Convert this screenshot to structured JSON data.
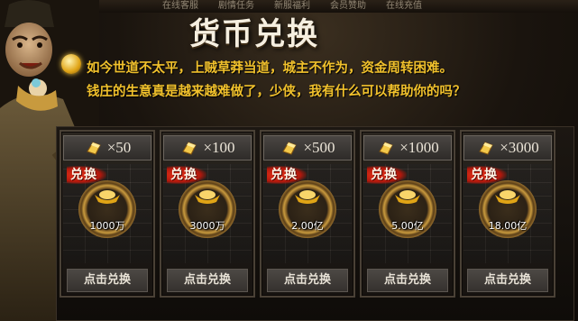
{
  "topbar": {
    "items": [
      "在线客服",
      "剧情任务",
      "新服福利",
      "会员赞助",
      "在线充值"
    ]
  },
  "title": "货币兑换",
  "dialog": {
    "line1": "如今世道不太平，上贼草莽当道，城主不作为，资金周转困难。",
    "line2": "钱庄的生意真是越来越难做了，少侠，我有什么可以帮助你的吗？"
  },
  "badge_label": "兑换",
  "cards": [
    {
      "amount": "×50",
      "yuanbao": "1000万",
      "button": "点击兑换"
    },
    {
      "amount": "×100",
      "yuanbao": "3000万",
      "button": "点击兑换"
    },
    {
      "amount": "×500",
      "yuanbao": "2.00亿",
      "button": "点击兑换"
    },
    {
      "amount": "×1000",
      "yuanbao": "5.00亿",
      "button": "点击兑换"
    },
    {
      "amount": "×3000",
      "yuanbao": "18.00亿",
      "button": "点击兑换"
    }
  ],
  "colors": {
    "dialog_text": "#f1c12c",
    "badge_red": "#d22a14",
    "gold": "#e0a416"
  },
  "icons": {
    "amount": "gold-bar-icon",
    "coin": "gold-ingot-icon",
    "npc": "merchant-npc-portrait"
  }
}
